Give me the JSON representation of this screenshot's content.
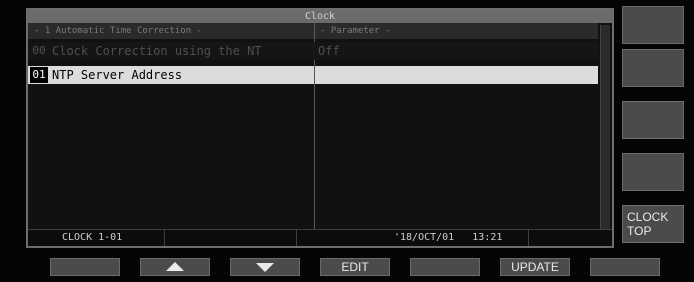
{
  "window": {
    "title": "Clock"
  },
  "table": {
    "header_left": "- 1 Automatic Time Correction -",
    "header_right": "- Parameter -",
    "rows": [
      {
        "num": "00",
        "label": "Clock Correction using the NT",
        "value": "Off"
      },
      {
        "num": "01",
        "label": "NTP Server Address",
        "value": ""
      }
    ]
  },
  "status": {
    "page": "CLOCK 1-01",
    "date": "'18/OCT/01",
    "time": "13:21"
  },
  "side_buttons": [
    "",
    "",
    "",
    "",
    "CLOCK\nTOP"
  ],
  "function_keys": [
    "",
    "up",
    "down",
    "EDIT",
    "",
    "UPDATE",
    ""
  ],
  "colors": {
    "background": "#050505",
    "title_bar": "#6b6b6b",
    "selected_row": "#dcdcdc",
    "button": "#4b4b4b"
  }
}
